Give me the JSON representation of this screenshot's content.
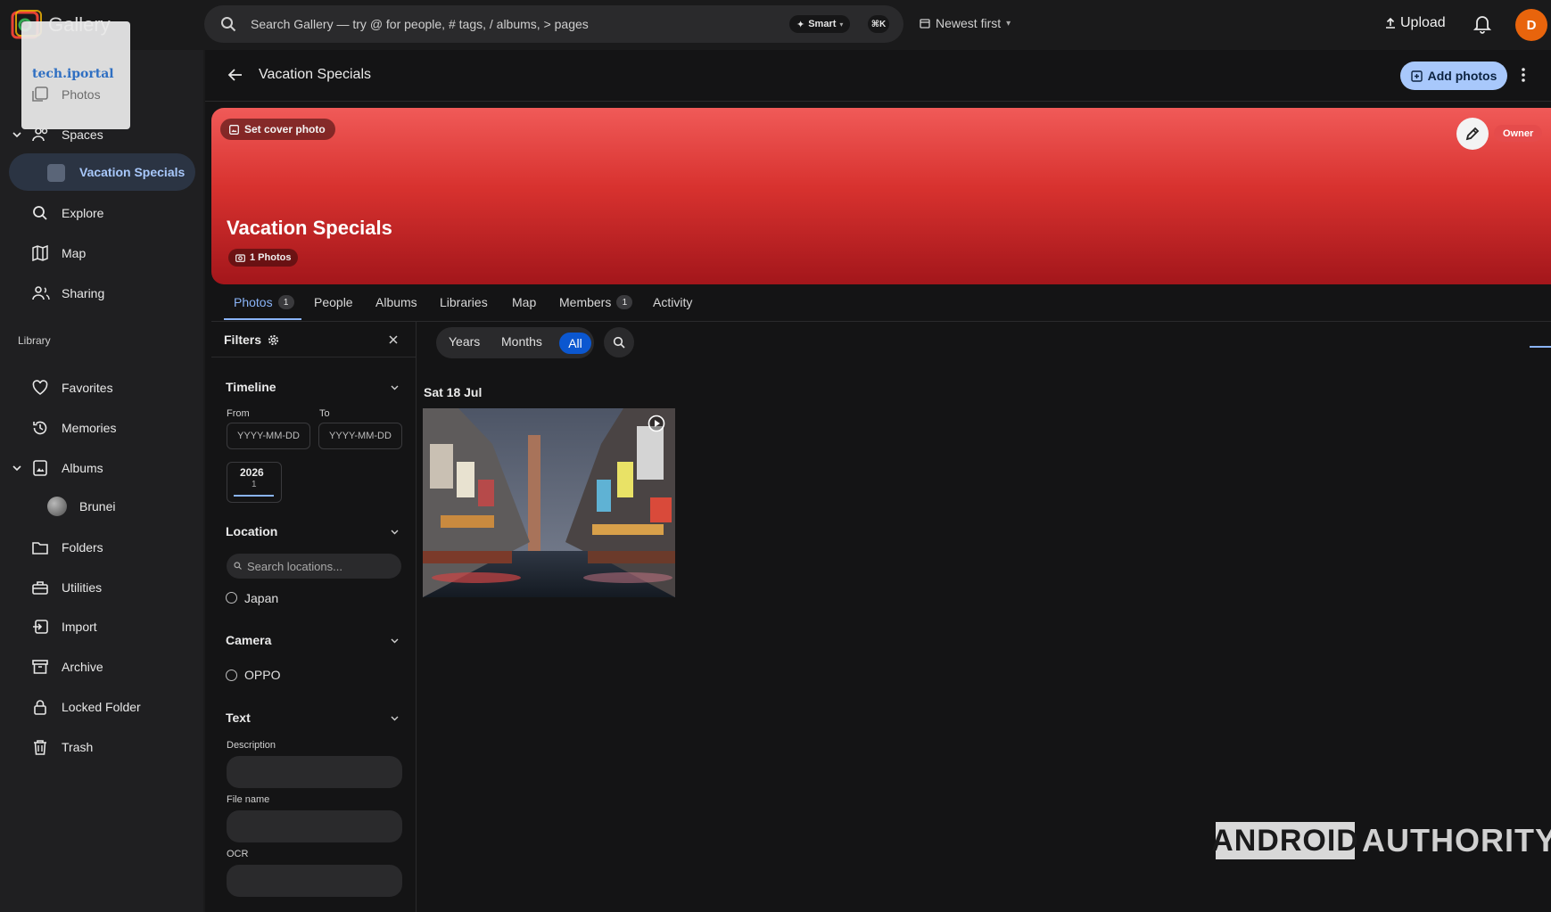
{
  "app": {
    "name": "Gallery"
  },
  "search": {
    "placeholder": "Search Gallery — try @ for people, # tags, / albums, > pages",
    "mode_label": "Smart",
    "shortcut": "⌘K"
  },
  "sort": {
    "label": "Newest first"
  },
  "header_actions": {
    "upload_label": "Upload",
    "avatar_letter": "D"
  },
  "watermarks": {
    "tech": "tech.iportal",
    "brand_left": "ANDROID",
    "brand_right": "AUTHORITY"
  },
  "sidebar": {
    "items": [
      {
        "id": "photos",
        "label": "Photos",
        "icon": "photos-icon"
      },
      {
        "id": "spaces",
        "label": "Spaces",
        "icon": "people-icon"
      },
      {
        "id": "vacation-specials",
        "label": "Vacation Specials",
        "icon": "space-thumb"
      },
      {
        "id": "explore",
        "label": "Explore",
        "icon": "search-icon"
      },
      {
        "id": "map",
        "label": "Map",
        "icon": "map-icon"
      },
      {
        "id": "sharing",
        "label": "Sharing",
        "icon": "sharing-icon"
      }
    ],
    "library_label": "Library",
    "library_items": [
      {
        "id": "favorites",
        "label": "Favorites",
        "icon": "heart-icon"
      },
      {
        "id": "memories",
        "label": "Memories",
        "icon": "history-icon"
      },
      {
        "id": "albums",
        "label": "Albums",
        "icon": "album-icon"
      },
      {
        "id": "brunei",
        "label": "Brunei",
        "icon": "album-thumb"
      },
      {
        "id": "folders",
        "label": "Folders",
        "icon": "folder-icon"
      },
      {
        "id": "utilities",
        "label": "Utilities",
        "icon": "toolbox-icon"
      },
      {
        "id": "import",
        "label": "Import",
        "icon": "import-icon"
      },
      {
        "id": "archive",
        "label": "Archive",
        "icon": "archive-icon"
      },
      {
        "id": "locked",
        "label": "Locked Folder",
        "icon": "lock-icon"
      },
      {
        "id": "trash",
        "label": "Trash",
        "icon": "trash-icon"
      }
    ]
  },
  "page": {
    "title": "Vacation Specials",
    "add_photos_label": "Add photos",
    "banner": {
      "set_cover_label": "Set cover photo",
      "title": "Vacation Specials",
      "photos_chip": "1 Photos",
      "owner_badge": "Owner",
      "color_top": "#f05a58",
      "color_bottom": "#a3161b"
    },
    "tabs": [
      {
        "label": "Photos",
        "count": "1"
      },
      {
        "label": "People"
      },
      {
        "label": "Albums"
      },
      {
        "label": "Libraries"
      },
      {
        "label": "Map"
      },
      {
        "label": "Members",
        "count": "1"
      },
      {
        "label": "Activity"
      }
    ],
    "active_tab": "Photos"
  },
  "filters": {
    "title": "Filters",
    "timeline": {
      "title": "Timeline",
      "from_label": "From",
      "to_label": "To",
      "from_placeholder": "YYYY-MM-DD",
      "to_placeholder": "YYYY-MM-DD",
      "year": "2026",
      "year_count": "1"
    },
    "location": {
      "title": "Location",
      "search_placeholder": "Search locations...",
      "options": [
        "Japan"
      ]
    },
    "camera": {
      "title": "Camera",
      "options": [
        "OPPO"
      ]
    },
    "text": {
      "title": "Text",
      "fields": [
        "Description",
        "File name",
        "OCR"
      ]
    }
  },
  "toolbar": {
    "ranges": [
      "Years",
      "Months",
      "All"
    ],
    "active_range": "All"
  },
  "grid": {
    "groups": [
      {
        "date": "Sat 18 Jul",
        "items": 1
      }
    ]
  },
  "colors": {
    "accent": "#0b57d0",
    "primary_button": "#a8c8fb",
    "avatar": "#e8640c",
    "highlight": "#8ab4f8"
  }
}
